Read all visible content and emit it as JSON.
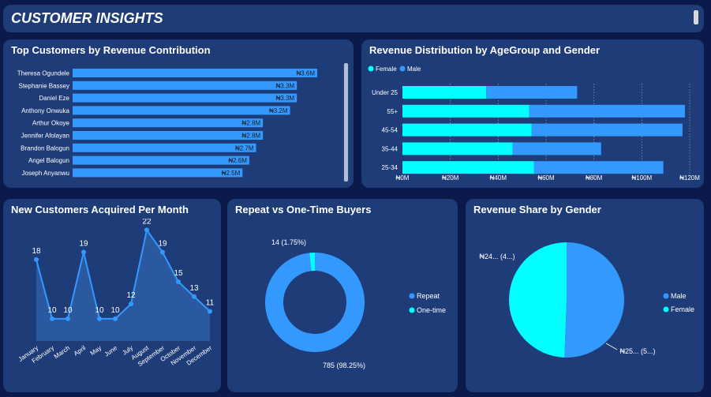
{
  "header": {
    "title": "CUSTOMER INSIGHTS"
  },
  "colors": {
    "female": "#00ffff",
    "male": "#3399ff",
    "background": "#0b1a4a",
    "card": "#1e3c78"
  },
  "top_customers": {
    "title": "Top Customers by Revenue Contribution",
    "chart_data": {
      "type": "bar",
      "orientation": "horizontal",
      "categories": [
        "Theresa Ogundele",
        "Stephanie Bassey",
        "Daniel Eze",
        "Anthony Onwuka",
        "Arthur Okoye",
        "Jennifer Afolayan",
        "Brandon Balogun",
        "Angel Balogun",
        "Joseph Anyanwu"
      ],
      "values": [
        3.6,
        3.3,
        3.3,
        3.2,
        2.8,
        2.8,
        2.7,
        2.6,
        2.5
      ],
      "value_labels": [
        "₦3.6M",
        "₦3.3M",
        "₦3.3M",
        "₦3.2M",
        "₦2.8M",
        "₦2.8M",
        "₦2.7M",
        "₦2.6M",
        "₦2.5M"
      ],
      "unit": "M"
    }
  },
  "age_gender": {
    "title": "Revenue Distribution by AgeGroup and Gender",
    "legend": [
      "Female",
      "Male"
    ],
    "chart_data": {
      "type": "bar",
      "orientation": "horizontal",
      "stacked": true,
      "categories": [
        "Under 25",
        "55+",
        "45-54",
        "35-44",
        "25-34"
      ],
      "series": [
        {
          "name": "Female",
          "values": [
            35,
            53,
            54,
            46,
            55
          ]
        },
        {
          "name": "Male",
          "values": [
            38,
            65,
            63,
            37,
            54
          ]
        }
      ],
      "xlim": [
        0,
        120
      ],
      "tick_values": [
        0,
        20,
        40,
        60,
        80,
        100,
        120
      ],
      "tick_labels": [
        "₦0M",
        "₦20M",
        "₦40M",
        "₦60M",
        "₦80M",
        "₦100M",
        "₦120M"
      ],
      "legend_position": "top-left"
    }
  },
  "new_customers": {
    "title": "New Customers Acquired Per Month",
    "chart_data": {
      "type": "area",
      "categories": [
        "January",
        "February",
        "March",
        "April",
        "May",
        "June",
        "July",
        "August",
        "September",
        "October",
        "November",
        "December"
      ],
      "values": [
        18,
        10,
        10,
        19,
        10,
        10,
        12,
        22,
        19,
        15,
        13,
        11
      ],
      "ylim": [
        7,
        23
      ]
    }
  },
  "repeat_buyers": {
    "title": "Repeat vs One-Time Buyers",
    "legend": [
      "Repeat",
      "One-time"
    ],
    "chart_data": {
      "type": "pie",
      "donut": true,
      "labels": [
        "Repeat",
        "One-time"
      ],
      "values": [
        785,
        14
      ],
      "data_labels": [
        "785 (98.25%)",
        "14 (1.75%)"
      ],
      "legend_position": "right"
    }
  },
  "gender_share": {
    "title": "Revenue Share by Gender",
    "legend": [
      "Male",
      "Female"
    ],
    "chart_data": {
      "type": "pie",
      "labels": [
        "Male",
        "Female"
      ],
      "values": [
        50.6,
        49.4
      ],
      "data_labels": [
        "₦25... (5...)",
        "₦24... (4...)"
      ],
      "legend_position": "right"
    }
  }
}
